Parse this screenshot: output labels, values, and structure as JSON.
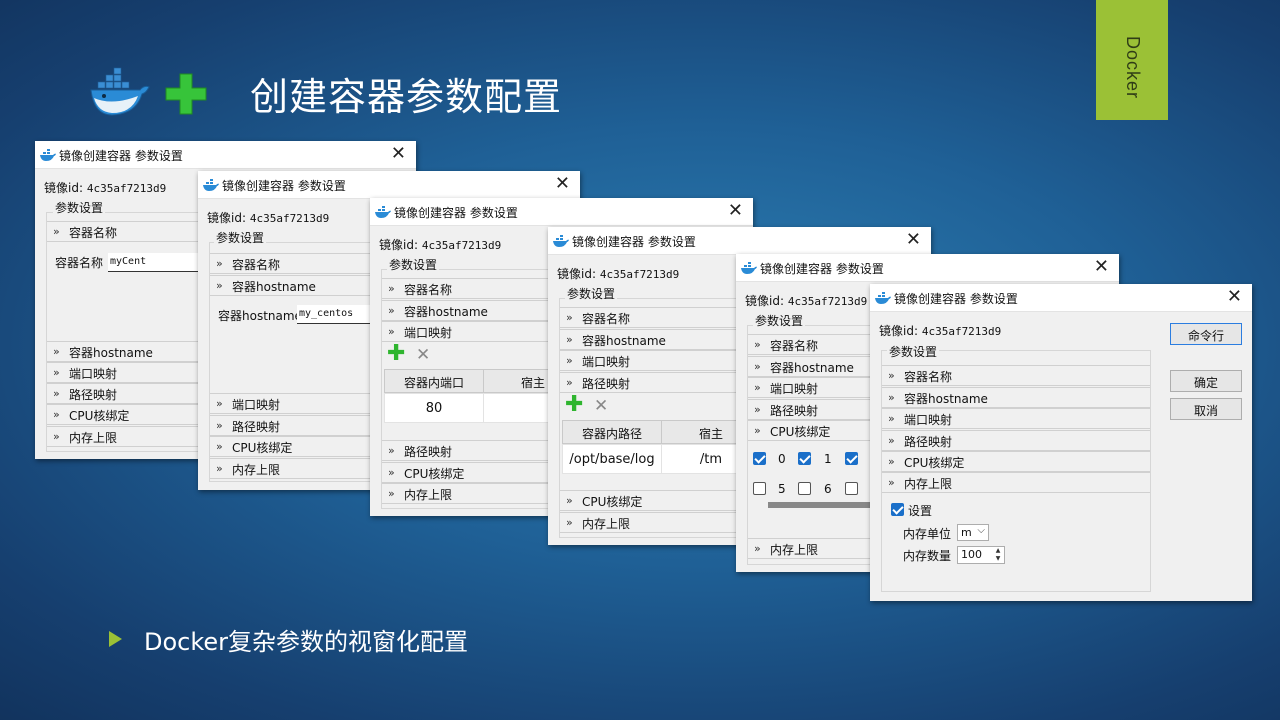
{
  "slide": {
    "title": "创建容器参数配置",
    "side_tab": "Docker",
    "bullet": "Docker复杂参数的视窗化配置",
    "accent_color": "#9bc136"
  },
  "dialog": {
    "title": "镜像创建容器 参数设置",
    "close_glyph": "✕",
    "image_id_label": "镜像id:",
    "image_id": "4c35af7213d9",
    "group_label": "参数设置",
    "chevron": "»"
  },
  "sections": {
    "name": "容器名称",
    "hostname": "容器hostname",
    "port": "端口映射",
    "path": "路径映射",
    "cpu": "CPU核绑定",
    "mem": "内存上限"
  },
  "win1": {
    "name_label": "容器名称",
    "name_value": "myCent"
  },
  "win2": {
    "hostname_label": "容器hostname",
    "hostname_value": "my_centos"
  },
  "win3": {
    "columns": [
      "容器内端口",
      "宿主"
    ],
    "rows": [
      [
        "80",
        ""
      ]
    ]
  },
  "win4": {
    "columns": [
      "容器内路径",
      "宿主"
    ],
    "rows": [
      [
        "/opt/base/log",
        "/tm"
      ]
    ]
  },
  "win5": {
    "cores": [
      {
        "label": "0",
        "checked": true
      },
      {
        "label": "1",
        "checked": true
      },
      {
        "label": "",
        "checked": true
      },
      {
        "label": "5",
        "checked": false
      },
      {
        "label": "6",
        "checked": false
      },
      {
        "label": "",
        "checked": false
      }
    ]
  },
  "win6": {
    "cmd_button": "命令行",
    "ok_button": "确定",
    "cancel_button": "取消",
    "setting_checkbox": "设置",
    "mem_unit_label": "内存单位",
    "mem_unit_value": "m",
    "mem_count_label": "内存数量",
    "mem_count_value": "100"
  }
}
